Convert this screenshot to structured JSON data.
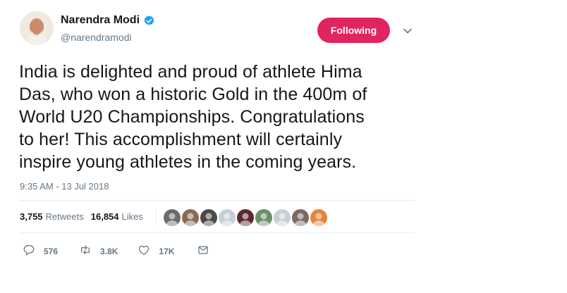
{
  "author": {
    "name": "Narendra Modi",
    "handle": "@narendramodi",
    "verified": true
  },
  "follow_button": {
    "label": "Following",
    "color": "#e0245e"
  },
  "tweet": {
    "lines": [
      "India is delighted and proud of athlete Hima",
      "Das, who won a historic Gold in the 400m of",
      "World U20 Championships. Congratulations",
      "to her! This accomplishment will certainly",
      "inspire young athletes in the coming years."
    ],
    "timestamp": "9:35 AM - 13 Jul 2018"
  },
  "stats": {
    "retweets_count": "3,755",
    "retweets_label": "Retweets",
    "likes_count": "16,854",
    "likes_label": "Likes"
  },
  "liker_avatars": [
    {
      "name": "liker-avatar-1",
      "color": "#6b6b6b"
    },
    {
      "name": "liker-avatar-2",
      "color": "#8a6a52"
    },
    {
      "name": "liker-avatar-3",
      "color": "#4a4a4a"
    },
    {
      "name": "liker-avatar-4",
      "color": "#c5cfd6"
    },
    {
      "name": "liker-avatar-5",
      "color": "#5a2a2a"
    },
    {
      "name": "liker-avatar-6",
      "color": "#6c8f6a"
    },
    {
      "name": "liker-avatar-7",
      "color": "#c5cfd6"
    },
    {
      "name": "liker-avatar-8",
      "color": "#7a6a60"
    },
    {
      "name": "liker-avatar-9",
      "color": "#e8833a"
    }
  ],
  "actions": {
    "replies": "576",
    "retweets": "3.8K",
    "likes": "17K"
  },
  "colors": {
    "text_primary": "#14171a",
    "text_secondary": "#657786",
    "verified_blue": "#1da1f2",
    "divider": "#e6ecf0"
  },
  "icons": [
    "verified-badge-icon",
    "chevron-down-icon",
    "reply-icon",
    "retweet-icon",
    "like-icon",
    "direct-message-icon"
  ]
}
